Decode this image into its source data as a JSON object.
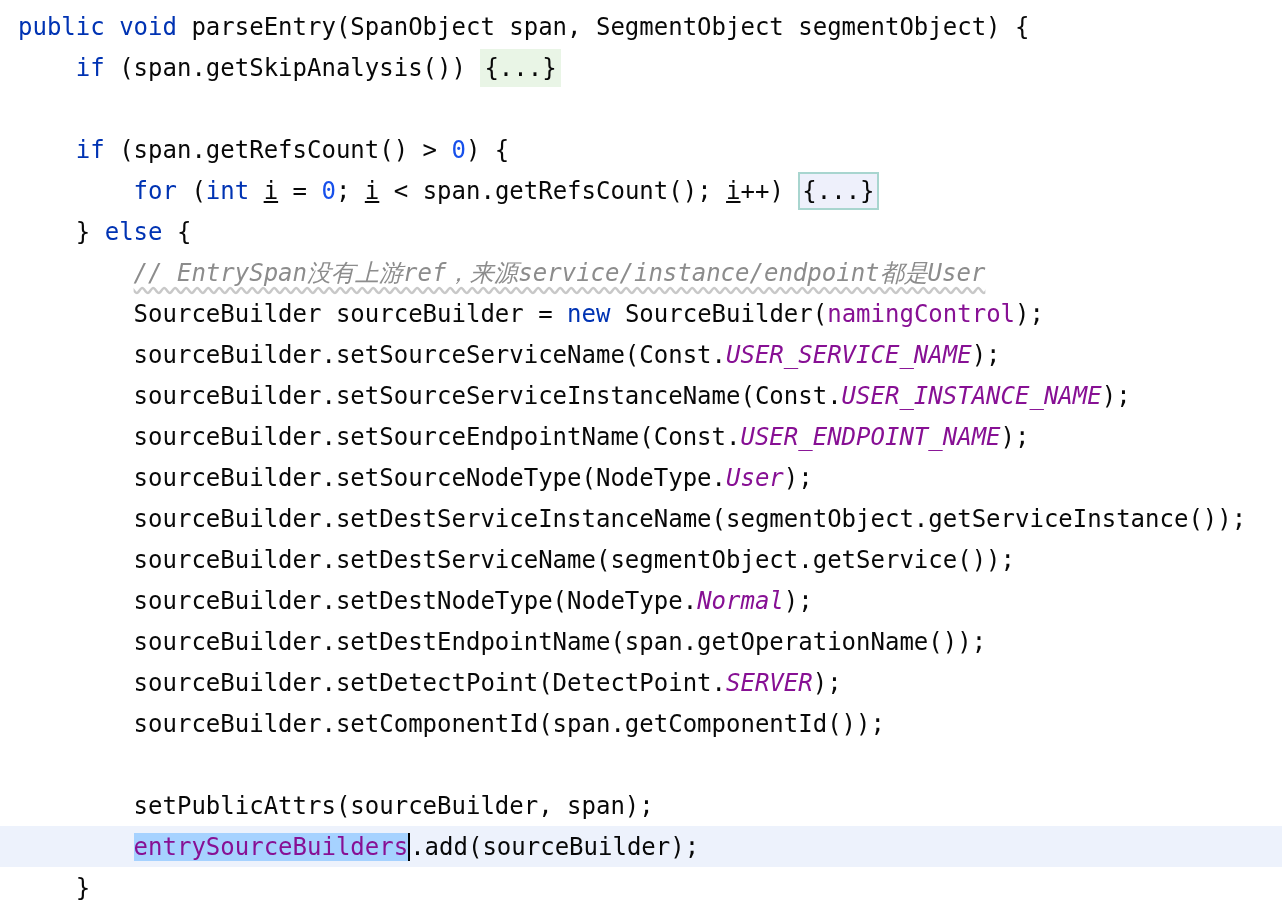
{
  "editor": {
    "lines": [
      {
        "current": false,
        "tokens": [
          {
            "kind": "keyword",
            "text": "public void "
          },
          {
            "kind": "plain",
            "text": "parseEntry(SpanObject span, SegmentObject segmentObject) {"
          }
        ],
        "children": [
          {
            "current": false,
            "tokens": [
              {
                "kind": "keyword",
                "text": "if"
              },
              {
                "kind": "plain",
                "text": " (span.getSkipAnalysis()) "
              },
              {
                "kind": "fold",
                "text": "{...}",
                "selected": false
              }
            ]
          },
          {
            "current": false
          },
          {
            "current": false,
            "tokens": [
              {
                "kind": "keyword",
                "text": "if"
              },
              {
                "kind": "plain",
                "text": " (span.getRefsCount() > "
              },
              {
                "kind": "number",
                "text": "0"
              },
              {
                "kind": "plain",
                "text": ") {"
              }
            ],
            "children": [
              {
                "current": false,
                "tokens": [
                  {
                    "kind": "keyword",
                    "text": "for"
                  },
                  {
                    "kind": "plain",
                    "text": " ("
                  },
                  {
                    "kind": "keyword",
                    "text": "int "
                  },
                  {
                    "kind": "var",
                    "text": "i"
                  },
                  {
                    "kind": "plain",
                    "text": " = "
                  },
                  {
                    "kind": "number",
                    "text": "0"
                  },
                  {
                    "kind": "plain",
                    "text": "; "
                  },
                  {
                    "kind": "var",
                    "text": "i"
                  },
                  {
                    "kind": "plain",
                    "text": " < span.getRefsCount(); "
                  },
                  {
                    "kind": "var",
                    "text": "i"
                  },
                  {
                    "kind": "plain",
                    "text": "++) "
                  },
                  {
                    "kind": "fold",
                    "text": "{...}",
                    "selected": true
                  }
                ]
              }
            ]
          },
          {
            "current": false,
            "tokens": [
              {
                "kind": "plain",
                "text": "} "
              },
              {
                "kind": "keyword",
                "text": "else"
              },
              {
                "kind": "plain",
                "text": " {"
              }
            ],
            "children": [
              {
                "current": false,
                "tokens": [
                  {
                    "kind": "comment",
                    "text": "// EntrySpan没有上游ref，来源service/instance/endpoint都是User",
                    "flagged": true
                  }
                ]
              },
              {
                "current": false,
                "tokens": [
                  {
                    "kind": "plain",
                    "text": "SourceBuilder sourceBuilder = "
                  },
                  {
                    "kind": "keyword",
                    "text": "new"
                  },
                  {
                    "kind": "plain",
                    "text": " SourceBuilder("
                  },
                  {
                    "kind": "field",
                    "text": "namingControl"
                  },
                  {
                    "kind": "plain",
                    "text": ");"
                  }
                ]
              },
              {
                "current": false,
                "tokens": [
                  {
                    "kind": "plain",
                    "text": "sourceBuilder.setSourceServiceName(Const."
                  },
                  {
                    "kind": "const",
                    "text": "USER_SERVICE_NAME"
                  },
                  {
                    "kind": "plain",
                    "text": ");"
                  }
                ]
              },
              {
                "current": false,
                "tokens": [
                  {
                    "kind": "plain",
                    "text": "sourceBuilder.setSourceServiceInstanceName(Const."
                  },
                  {
                    "kind": "const",
                    "text": "USER_INSTANCE_NAME"
                  },
                  {
                    "kind": "plain",
                    "text": ");"
                  }
                ]
              },
              {
                "current": false,
                "tokens": [
                  {
                    "kind": "plain",
                    "text": "sourceBuilder.setSourceEndpointName(Const."
                  },
                  {
                    "kind": "const",
                    "text": "USER_ENDPOINT_NAME"
                  },
                  {
                    "kind": "plain",
                    "text": ");"
                  }
                ]
              },
              {
                "current": false,
                "tokens": [
                  {
                    "kind": "plain",
                    "text": "sourceBuilder.setSourceNodeType(NodeType."
                  },
                  {
                    "kind": "const",
                    "text": "User"
                  },
                  {
                    "kind": "plain",
                    "text": ");"
                  }
                ]
              },
              {
                "current": false,
                "tokens": [
                  {
                    "kind": "plain",
                    "text": "sourceBuilder.setDestServiceInstanceName(segmentObject.getServiceInstance());"
                  }
                ]
              },
              {
                "current": false,
                "tokens": [
                  {
                    "kind": "plain",
                    "text": "sourceBuilder.setDestServiceName(segmentObject.getService());"
                  }
                ]
              },
              {
                "current": false,
                "tokens": [
                  {
                    "kind": "plain",
                    "text": "sourceBuilder.setDestNodeType(NodeType."
                  },
                  {
                    "kind": "const",
                    "text": "Normal"
                  },
                  {
                    "kind": "plain",
                    "text": ");"
                  }
                ]
              },
              {
                "current": false,
                "tokens": [
                  {
                    "kind": "plain",
                    "text": "sourceBuilder.setDestEndpointName(span.getOperationName());"
                  }
                ]
              },
              {
                "current": false,
                "tokens": [
                  {
                    "kind": "plain",
                    "text": "sourceBuilder.setDetectPoint(DetectPoint."
                  },
                  {
                    "kind": "const",
                    "text": "SERVER"
                  },
                  {
                    "kind": "plain",
                    "text": ");"
                  }
                ]
              },
              {
                "current": false,
                "tokens": [
                  {
                    "kind": "plain",
                    "text": "sourceBuilder.setComponentId(span.getComponentId());"
                  }
                ]
              },
              {
                "current": false
              },
              {
                "current": false,
                "tokens": [
                  {
                    "kind": "plain",
                    "text": "setPublicAttrs(sourceBuilder, span);"
                  }
                ]
              },
              {
                "current": true,
                "tokens": [
                  {
                    "kind": "field",
                    "text": "entrySourceBuilders",
                    "selected": true
                  },
                  {
                    "kind": "plain",
                    "text": ".add(sourceBuilder);"
                  }
                ]
              }
            ]
          },
          {
            "current": false,
            "tokens": [
              {
                "kind": "plain",
                "text": "}"
              }
            ]
          }
        ]
      }
    ]
  }
}
